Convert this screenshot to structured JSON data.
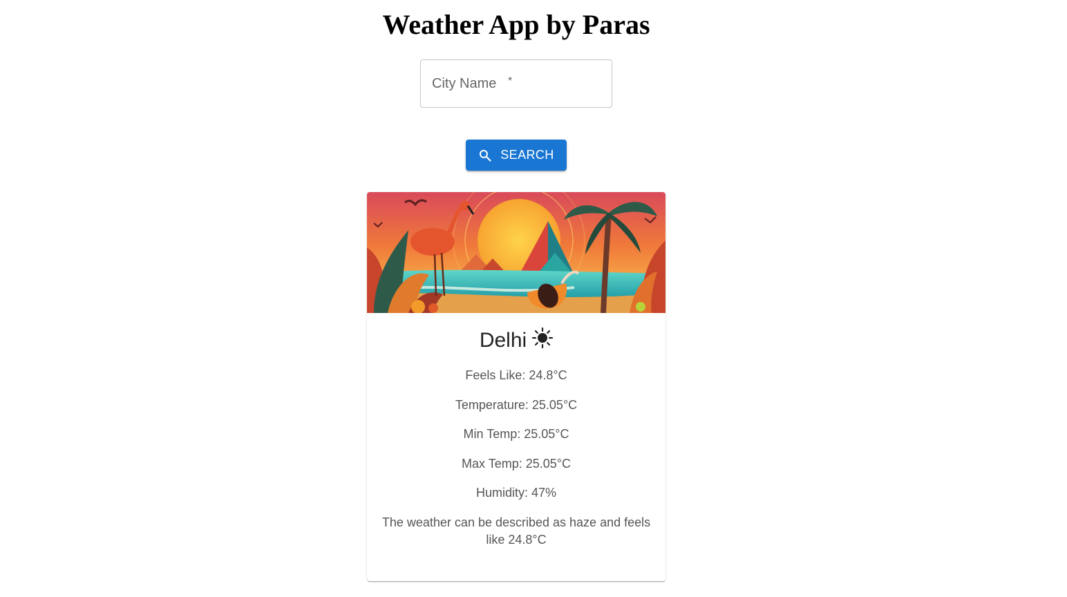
{
  "header": {
    "title": "Weather App by Paras"
  },
  "search": {
    "placeholder": "City Name",
    "required_mark": "*",
    "value": "",
    "button_label": "SEARCH",
    "button_icon": "search-icon"
  },
  "weather_card": {
    "image": "tropical-sunset-illustration",
    "city": "Delhi",
    "condition_icon": "sun-icon",
    "details": {
      "feels_like": "Feels Like: 24.8°C",
      "temperature": "Temperature: 25.05°C",
      "min_temp": "Min Temp: 25.05°C",
      "max_temp": "Max Temp: 25.05°C",
      "humidity": "Humidity: 47%"
    },
    "description": "The weather can be described as haze and feels like 24.8°C"
  },
  "colors": {
    "primary": "#1976d2",
    "text_secondary": "#555555",
    "border": "#c4c4c4"
  }
}
